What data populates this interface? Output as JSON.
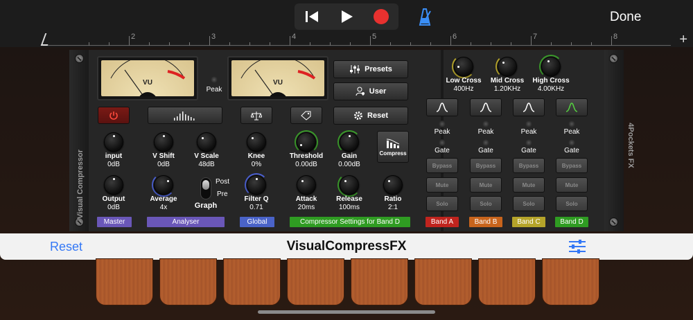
{
  "transport": {
    "rewind": "rewind-icon",
    "play": "play-icon",
    "record": "record-icon",
    "metronome": "metronome-icon",
    "done_label": "Done"
  },
  "ruler": {
    "bars": [
      "2",
      "3",
      "4",
      "5",
      "6",
      "7",
      "8"
    ],
    "add": "+"
  },
  "plugin": {
    "left_title": "Visual Compressor",
    "right_title": "4Pockets FX",
    "vu_left": {
      "label": "VU",
      "scale": [
        "20",
        "10",
        "7",
        "5",
        "3",
        "1",
        "0",
        "1",
        "2"
      ]
    },
    "vu_right": {
      "label": "VU",
      "scale": [
        "20",
        "10",
        "7",
        "5",
        "3",
        "1",
        "0",
        "1",
        "2"
      ]
    },
    "peak_label": "Peak",
    "presets_label": "Presets",
    "user_label": "User",
    "reset_label": "Reset",
    "compress_label": "Compress",
    "knobs": {
      "input": {
        "label": "input",
        "value": "0dB"
      },
      "output": {
        "label": "Output",
        "value": "0dB"
      },
      "v_shift": {
        "label": "V Shift",
        "value": "0dB"
      },
      "v_scale": {
        "label": "V Scale",
        "value": "48dB"
      },
      "average": {
        "label": "Average",
        "value": "4x"
      },
      "knee": {
        "label": "Knee",
        "value": "0%"
      },
      "filter_q": {
        "label": "Filter Q",
        "value": "0.71"
      },
      "threshold": {
        "label": "Threshold",
        "value": "0.00dB"
      },
      "gain": {
        "label": "Gain",
        "value": "0.00dB"
      },
      "attack": {
        "label": "Attack",
        "value": "20ms"
      },
      "release": {
        "label": "Release",
        "value": "100ms"
      },
      "ratio": {
        "label": "Ratio",
        "value": "2:1"
      },
      "low_cross": {
        "label": "Low Cross",
        "value": "400Hz"
      },
      "mid_cross": {
        "label": "Mid Cross",
        "value": "1.20KHz"
      },
      "high_cross": {
        "label": "High Cross",
        "value": "4.00KHz"
      }
    },
    "graph": {
      "post": "Post",
      "pre": "Pre",
      "label": "Graph"
    },
    "bands": [
      {
        "peak": "Peak",
        "gate": "Gate",
        "bypass": "Bypass",
        "mute": "Mute",
        "solo": "Solo",
        "tag": "Band A",
        "color": "#c0241e"
      },
      {
        "peak": "Peak",
        "gate": "Gate",
        "bypass": "Bypass",
        "mute": "Mute",
        "solo": "Solo",
        "tag": "Band B",
        "color": "#c8641c"
      },
      {
        "peak": "Peak",
        "gate": "Gate",
        "bypass": "Bypass",
        "mute": "Mute",
        "solo": "Solo",
        "tag": "Band C",
        "color": "#b5a42a"
      },
      {
        "peak": "Peak",
        "gate": "Gate",
        "bypass": "Bypass",
        "mute": "Mute",
        "solo": "Solo",
        "tag": "Band D",
        "color": "#2f9c22"
      }
    ],
    "sections": {
      "master": {
        "label": "Master",
        "color": "#6a57b8"
      },
      "analyser": {
        "label": "Analyser",
        "color": "#6a57b8"
      },
      "global": {
        "label": "Global",
        "color": "#4a63c8"
      },
      "compressor": {
        "label": "Compressor Settings for Band D",
        "color": "#2f9c22"
      }
    }
  },
  "plugbar": {
    "reset_label": "Reset",
    "title": "VisualCompressFX",
    "settings_icon": "sliders-icon"
  }
}
